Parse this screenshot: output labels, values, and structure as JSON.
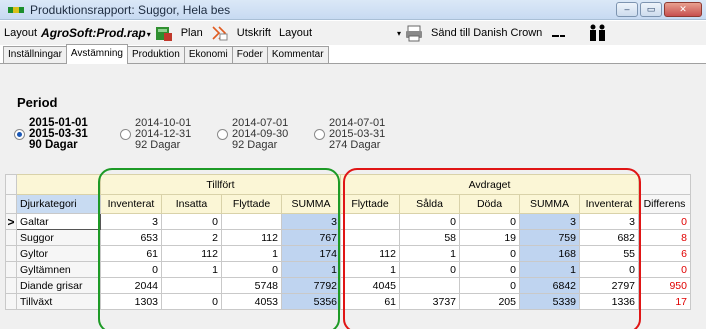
{
  "window": {
    "title": "Produktionsrapport: Suggor, Hela bes",
    "minimize": "‒",
    "maximize": "▭",
    "close": "✕"
  },
  "toolbar": {
    "layout_label": "Layout",
    "layout_value": "AgroSoft:Prod.rap",
    "layout_arrow": "▾",
    "plan_label": "Plan",
    "print_label": "Utskrift",
    "layout2_label": "Layout",
    "layout2_arrow": "▾",
    "send_label": "Sänd till Danish Crown"
  },
  "tabs": [
    "Inställningar",
    "Avstämning",
    "Produktion",
    "Ekonomi",
    "Foder",
    "Kommentar"
  ],
  "active_tab": "Avstämning",
  "period": {
    "heading": "Period",
    "options": [
      {
        "start": "2015-01-01",
        "end": "2015-03-31",
        "days": "90 Dagar",
        "selected": true
      },
      {
        "start": "2014-10-01",
        "end": "2014-12-31",
        "days": "92 Dagar",
        "selected": false
      },
      {
        "start": "2014-07-01",
        "end": "2014-09-30",
        "days": "92 Dagar",
        "selected": false
      },
      {
        "start": "2014-07-01",
        "end": "2015-03-31",
        "days": "274 Dagar",
        "selected": false
      }
    ]
  },
  "grid": {
    "group_tillfort": "Tillfört",
    "group_avdraget": "Avdraget",
    "col_category": "Djurkategori",
    "cols_tillfort": [
      "Inventerat",
      "Insatta",
      "Flyttade",
      "SUMMA"
    ],
    "cols_avdraget": [
      "Flyttade",
      "Sålda",
      "Döda",
      "SUMMA",
      "Inventerat"
    ],
    "col_diff": "Differens",
    "current_row_marker": ">",
    "rows": [
      {
        "name": "Galtar",
        "t_inv": "3",
        "t_ins": "0",
        "t_fly": "",
        "t_sum": "3",
        "a_fly": "",
        "a_sal": "0",
        "a_dod": "0",
        "a_sum": "3",
        "a_inv": "3",
        "diff": "0"
      },
      {
        "name": "Suggor",
        "t_inv": "653",
        "t_ins": "2",
        "t_fly": "112",
        "t_sum": "767",
        "a_fly": "",
        "a_sal": "58",
        "a_dod": "19",
        "a_sum": "759",
        "a_inv": "682",
        "diff": "8"
      },
      {
        "name": "Gyltor",
        "t_inv": "61",
        "t_ins": "112",
        "t_fly": "1",
        "t_sum": "174",
        "a_fly": "112",
        "a_sal": "1",
        "a_dod": "0",
        "a_sum": "168",
        "a_inv": "55",
        "diff": "6"
      },
      {
        "name": "Gyltämnen",
        "t_inv": "0",
        "t_ins": "1",
        "t_fly": "0",
        "t_sum": "1",
        "a_fly": "1",
        "a_sal": "0",
        "a_dod": "0",
        "a_sum": "1",
        "a_inv": "0",
        "diff": "0"
      },
      {
        "name": "Diande grisar",
        "t_inv": "2044",
        "t_ins": "",
        "t_fly": "5748",
        "t_sum": "7792",
        "a_fly": "4045",
        "a_sal": "",
        "a_dod": "0",
        "a_sum": "6842",
        "a_inv": "2797",
        "diff": "950"
      },
      {
        "name": "Tillväxt",
        "t_inv": "1303",
        "t_ins": "0",
        "t_fly": "4053",
        "t_sum": "5356",
        "a_fly": "61",
        "a_sal": "3737",
        "a_dod": "205",
        "a_sum": "5339",
        "a_inv": "1336",
        "diff": "17"
      }
    ]
  },
  "colors": {
    "tillfort_ring": "#1d9a26",
    "avdraget_ring": "#e01515",
    "diff_text": "#e00000",
    "summa_bg": "#bfd4f0"
  }
}
